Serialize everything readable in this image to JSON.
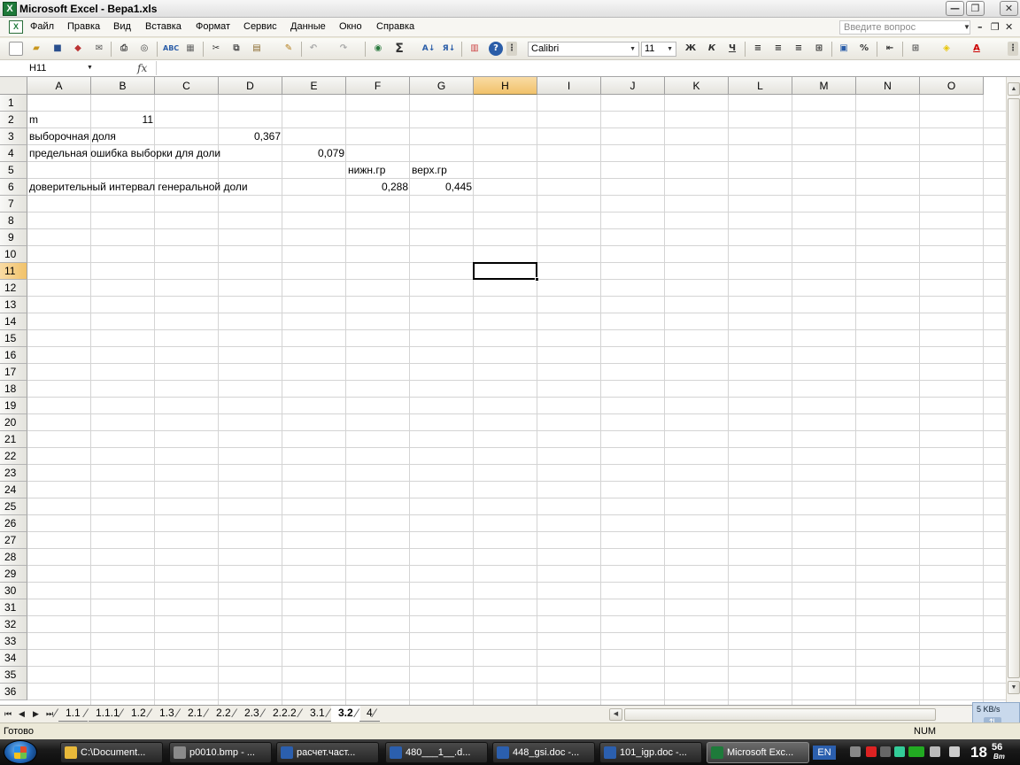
{
  "window": {
    "title": "Microsoft Excel - Вера1.xls",
    "min_glyph": "—",
    "max_glyph": "❐",
    "close_glyph": "✕"
  },
  "menu": {
    "items": [
      "Файл",
      "Правка",
      "Вид",
      "Вставка",
      "Формат",
      "Сервис",
      "Данные",
      "Окно",
      "Справка"
    ],
    "help_placeholder": "Введите вопрос"
  },
  "toolbar": {
    "font_name": "Calibri",
    "font_size": "11",
    "bold": "Ж",
    "italic": "К",
    "underline": "Ч",
    "percent": "%",
    "sum": "Σ"
  },
  "formula_bar": {
    "name_box": "H11",
    "fx": "fx",
    "value": ""
  },
  "sheet": {
    "columns": [
      "A",
      "B",
      "C",
      "D",
      "E",
      "F",
      "G",
      "H",
      "I",
      "J",
      "K",
      "L",
      "M",
      "N",
      "O"
    ],
    "rows": [
      "1",
      "2",
      "3",
      "4",
      "5",
      "6",
      "7",
      "8",
      "9",
      "10",
      "11",
      "12",
      "13",
      "14",
      "15",
      "16",
      "17",
      "18",
      "19",
      "20",
      "21",
      "22",
      "23",
      "24",
      "25",
      "26",
      "27",
      "28",
      "29",
      "30",
      "31",
      "32",
      "33",
      "34",
      "35",
      "36"
    ],
    "selected_column": "H",
    "selected_row": "11",
    "cells": {
      "A2": "m",
      "B2": "11",
      "A3": "выборочная доля",
      "D3": "0,367",
      "A4": "предельная ошибка выборки для доли",
      "E4": "0,079",
      "F5": "нижн.гр",
      "G5": "верх.гр",
      "A6": "доверительный интервал генеральной доли",
      "F6": "0,288",
      "G6": "0,445"
    }
  },
  "tabs": {
    "nav": [
      "⏮",
      "◀",
      "▶",
      "⏭"
    ],
    "items": [
      "1.1",
      "1.1.1",
      "1.2",
      "1.3",
      "2.1",
      "2.2",
      "2.3",
      "2.2.2",
      "3.1",
      "3.2",
      "4"
    ],
    "active": "3.2"
  },
  "status": {
    "ready": "Готово",
    "num": "NUM"
  },
  "netmeter": {
    "speed": "5 KB/s"
  },
  "taskbar": {
    "items": [
      {
        "label": "C:\\Document...",
        "icon": "folder-icon",
        "color": "#e8b93a"
      },
      {
        "label": "p0010.bmp - ...",
        "icon": "paint-icon",
        "color": "#8a8a8a"
      },
      {
        "label": "расчет.част...",
        "icon": "word-icon",
        "color": "#2b5fae"
      },
      {
        "label": "480___1__.d...",
        "icon": "word-icon",
        "color": "#2b5fae"
      },
      {
        "label": "448_gsi.doc -...",
        "icon": "word-icon",
        "color": "#2b5fae"
      },
      {
        "label": "101_igp.doc -...",
        "icon": "word-icon",
        "color": "#2b5fae"
      },
      {
        "label": "Microsoft Exc...",
        "icon": "excel-icon",
        "color": "#1e7a3a"
      }
    ],
    "active_index": 6,
    "lang": "EN",
    "clock_hour": "18",
    "clock_min": "56",
    "clock_day": "Вт"
  }
}
